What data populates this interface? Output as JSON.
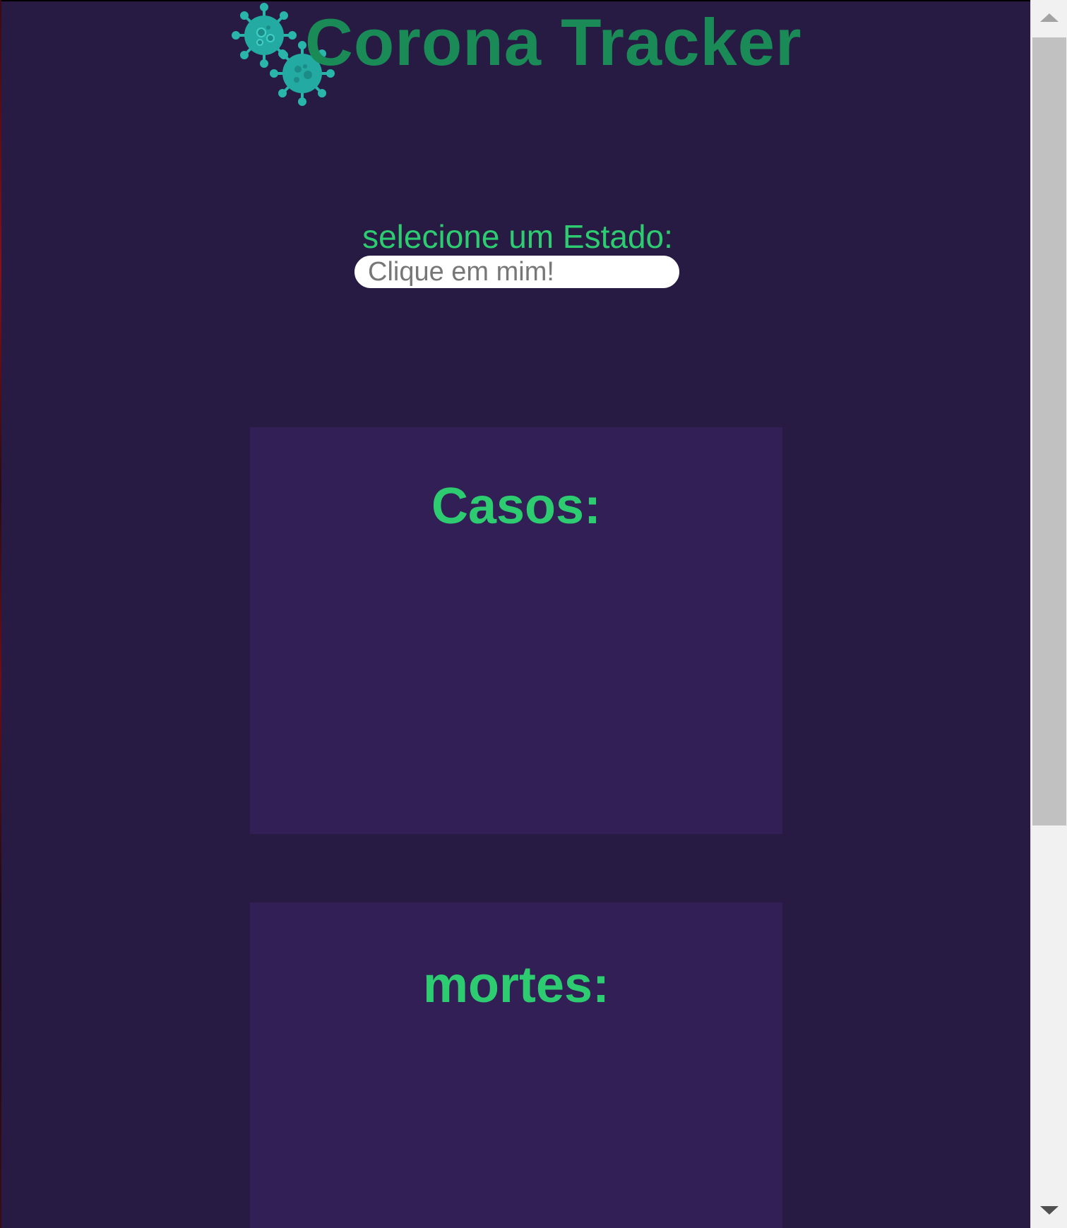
{
  "header": {
    "title": "Corona Tracker",
    "logo_icon": "virus-icon",
    "title_color": "#1a8b57",
    "icon_color": "#2ab5ac"
  },
  "selector": {
    "label": "selecione um Estado:",
    "placeholder": "Clique em mim!",
    "value": ""
  },
  "cards": {
    "cases": {
      "title": "Casos:",
      "value": ""
    },
    "deaths": {
      "title": "mortes:",
      "value": ""
    }
  },
  "colors": {
    "background": "#271a43",
    "card_background": "#311f55",
    "accent": "#2ecc71"
  }
}
